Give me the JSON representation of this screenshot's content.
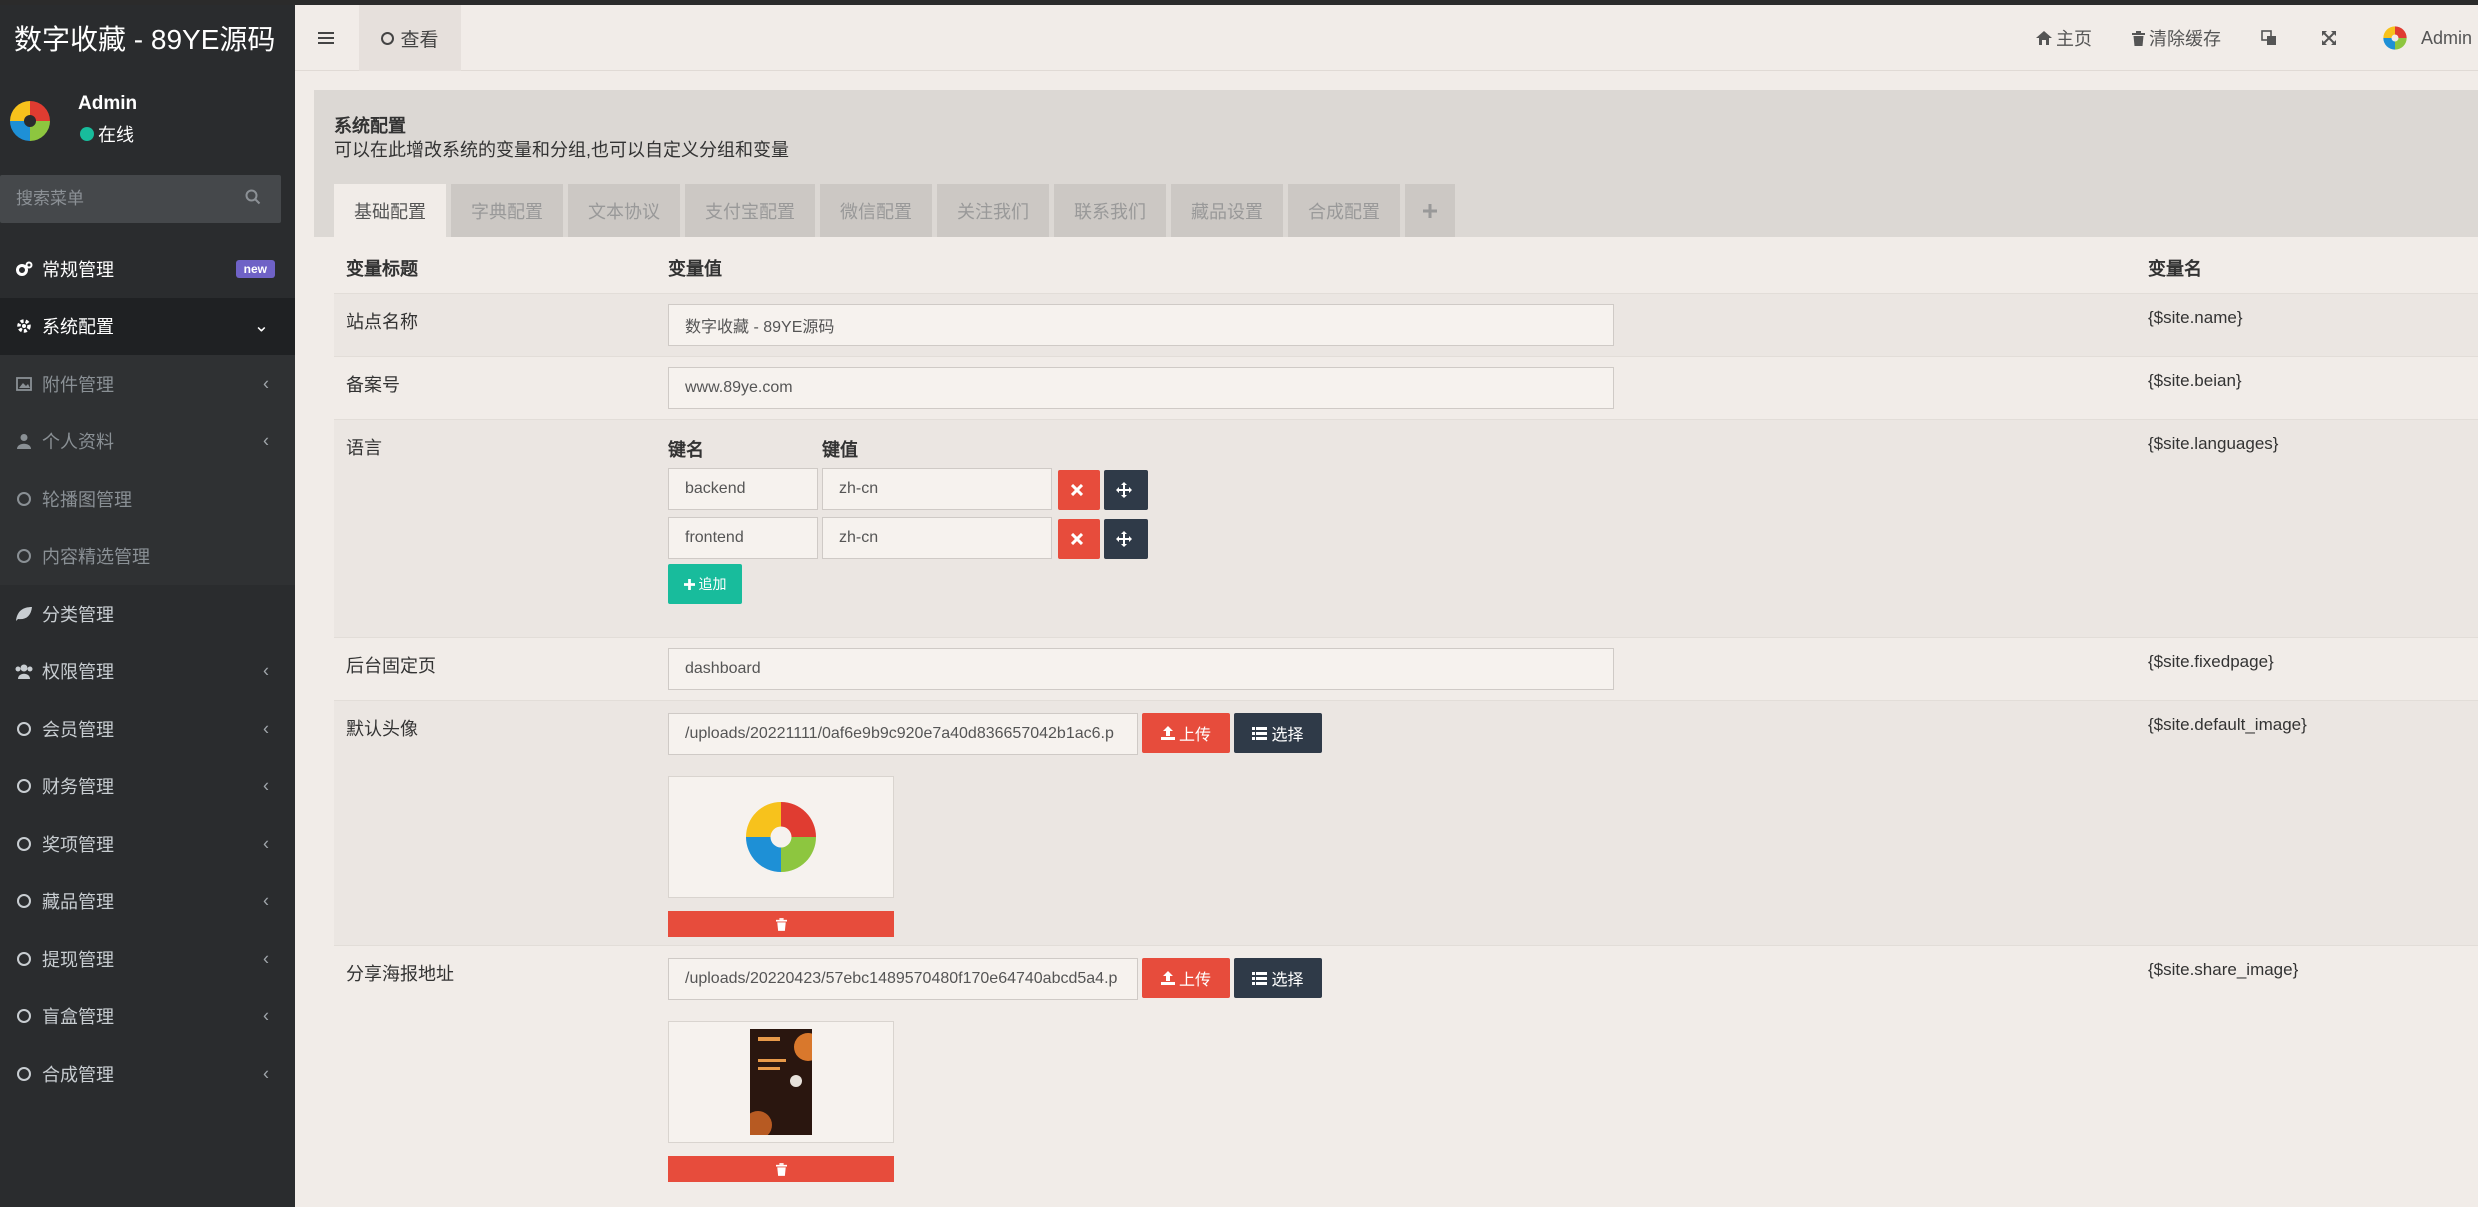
{
  "app": {
    "brand": "数字收藏 - 89YE源码",
    "user_name": "Admin",
    "user_status": "在线",
    "search_placeholder": "搜索菜单"
  },
  "sidebar": {
    "items": [
      {
        "label": "常规管理",
        "icon": "cogs-icon",
        "badge": "new"
      },
      {
        "label": "系统配置",
        "icon": "gear-icon",
        "active": true
      },
      {
        "label": "附件管理",
        "icon": "image-icon",
        "sub": true
      },
      {
        "label": "个人资料",
        "icon": "user-icon",
        "sub": true
      },
      {
        "label": "轮播图管理",
        "icon": "circle-icon",
        "sub": true
      },
      {
        "label": "内容精选管理",
        "icon": "circle-icon",
        "sub": true
      },
      {
        "label": "分类管理",
        "icon": "leaf-icon"
      },
      {
        "label": "权限管理",
        "icon": "group-icon"
      },
      {
        "label": "会员管理",
        "icon": "circle-icon"
      },
      {
        "label": "财务管理",
        "icon": "circle-icon"
      },
      {
        "label": "奖项管理",
        "icon": "circle-icon"
      },
      {
        "label": "藏品管理",
        "icon": "circle-icon"
      },
      {
        "label": "提现管理",
        "icon": "circle-icon"
      },
      {
        "label": "盲盒管理",
        "icon": "circle-icon"
      },
      {
        "label": "合成管理",
        "icon": "circle-icon"
      }
    ]
  },
  "header": {
    "view_tab": "查看",
    "home": "主页",
    "clear_cache": "清除缓存",
    "admin": "Admin"
  },
  "panel": {
    "title": "系统配置",
    "description": "可以在此增改系统的变量和分组,也可以自定义分组和变量",
    "tabs": [
      "基础配置",
      "字典配置",
      "文本协议",
      "支付宝配置",
      "微信配置",
      "关注我们",
      "联系我们",
      "藏品设置",
      "合成配置"
    ],
    "plus": "+"
  },
  "table": {
    "headers": {
      "title": "变量标题",
      "value": "变量值",
      "name": "变量名"
    },
    "site_name": {
      "title": "站点名称",
      "value": "数字收藏 - 89YE源码",
      "var": "{$site.name}"
    },
    "beian": {
      "title": "备案号",
      "value": "www.89ye.com",
      "var": "{$site.beian}"
    },
    "languages": {
      "title": "语言",
      "var": "{$site.languages}",
      "key_label": "键名",
      "value_label": "键值",
      "rows": [
        {
          "key": "backend",
          "value": "zh-cn"
        },
        {
          "key": "frontend",
          "value": "zh-cn"
        }
      ],
      "add_label": "追加"
    },
    "fixedpage": {
      "title": "后台固定页",
      "value": "dashboard",
      "var": "{$site.fixedpage}"
    },
    "default_image": {
      "title": "默认头像",
      "value": "/uploads/20221111/0af6e9b9c920e7a40d836657042b1ac6.p",
      "var": "{$site.default_image}"
    },
    "share_image": {
      "title": "分享海报地址",
      "value": "/uploads/20220423/57ebc1489570480f170e64740abcd5a4.p",
      "var": "{$site.share_image}"
    },
    "upload_label": "上传",
    "select_label": "选择"
  },
  "colors": {
    "sidebar_bg": "#2a2c2e",
    "accent_red": "#e74c3c",
    "accent_green": "#18bc9c",
    "dark_button": "#2f3a48",
    "badge": "#6f62c6"
  }
}
